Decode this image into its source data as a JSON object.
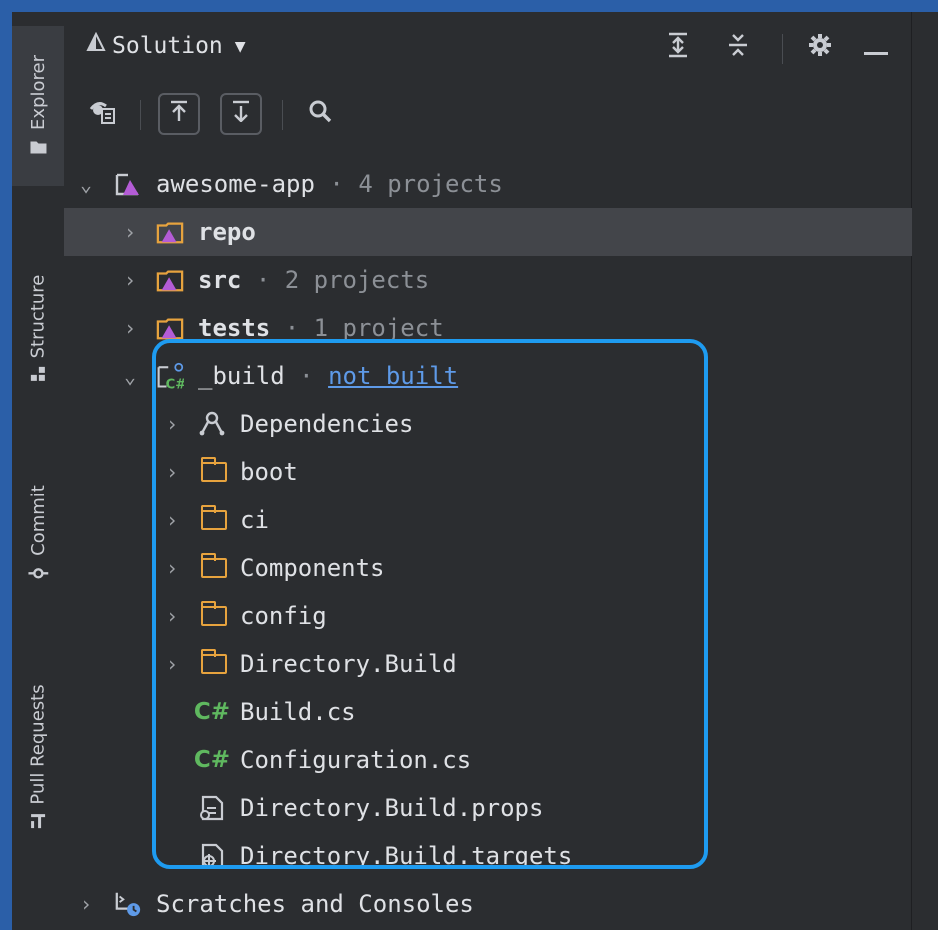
{
  "tool_tabs": [
    {
      "label": "Explorer",
      "icon": "folder-icon",
      "active": true
    },
    {
      "label": "Structure",
      "icon": "structure-icon",
      "active": false
    },
    {
      "label": "Commit",
      "icon": "commit-icon",
      "active": false
    },
    {
      "label": "Pull Requests",
      "icon": "pull-request-icon",
      "active": false
    }
  ],
  "header": {
    "title": "Solution",
    "dropdown_icon": "chevron-down-icon",
    "actions": [
      "expand-all-icon",
      "collapse-all-icon",
      "gear-icon",
      "minimize-icon"
    ]
  },
  "toolbar": {
    "buttons": [
      "show-hidden-icon",
      "collapse-up-icon",
      "collapse-down-icon",
      "search-icon"
    ]
  },
  "tree": {
    "root": {
      "name": "awesome-app",
      "sep": "·",
      "meta": "4 projects"
    },
    "items": [
      {
        "name": "repo",
        "meta": "",
        "selected": true
      },
      {
        "name": "src",
        "sep": "·",
        "meta": "2 projects"
      },
      {
        "name": "tests",
        "sep": "·",
        "meta": "1 project"
      }
    ],
    "build": {
      "name": "_build",
      "sep": "·",
      "status": "not built",
      "children": [
        {
          "name": "Dependencies",
          "icon": "dependencies-icon"
        },
        {
          "name": "boot",
          "icon": "folder-icon"
        },
        {
          "name": "ci",
          "icon": "folder-icon"
        },
        {
          "name": "Components",
          "icon": "folder-icon"
        },
        {
          "name": "config",
          "icon": "folder-icon"
        },
        {
          "name": "Directory.Build",
          "icon": "folder-icon"
        },
        {
          "name": "Build.cs",
          "icon": "csharp-icon"
        },
        {
          "name": "Configuration.cs",
          "icon": "csharp-icon"
        },
        {
          "name": "Directory.Build.props",
          "icon": "props-file-icon"
        },
        {
          "name": "Directory.Build.targets",
          "icon": "targets-file-icon"
        }
      ],
      "cs_badge": "C#"
    },
    "scratches": {
      "name": "Scratches and Consoles"
    }
  },
  "colors": {
    "background": "#2b2d30",
    "selection": "#43454a",
    "highlight": "#1e9bf0",
    "folder": "#e7a33e",
    "csharp": "#5fb85f",
    "link": "#5e9ae8",
    "outer": "#2b5fa8"
  }
}
